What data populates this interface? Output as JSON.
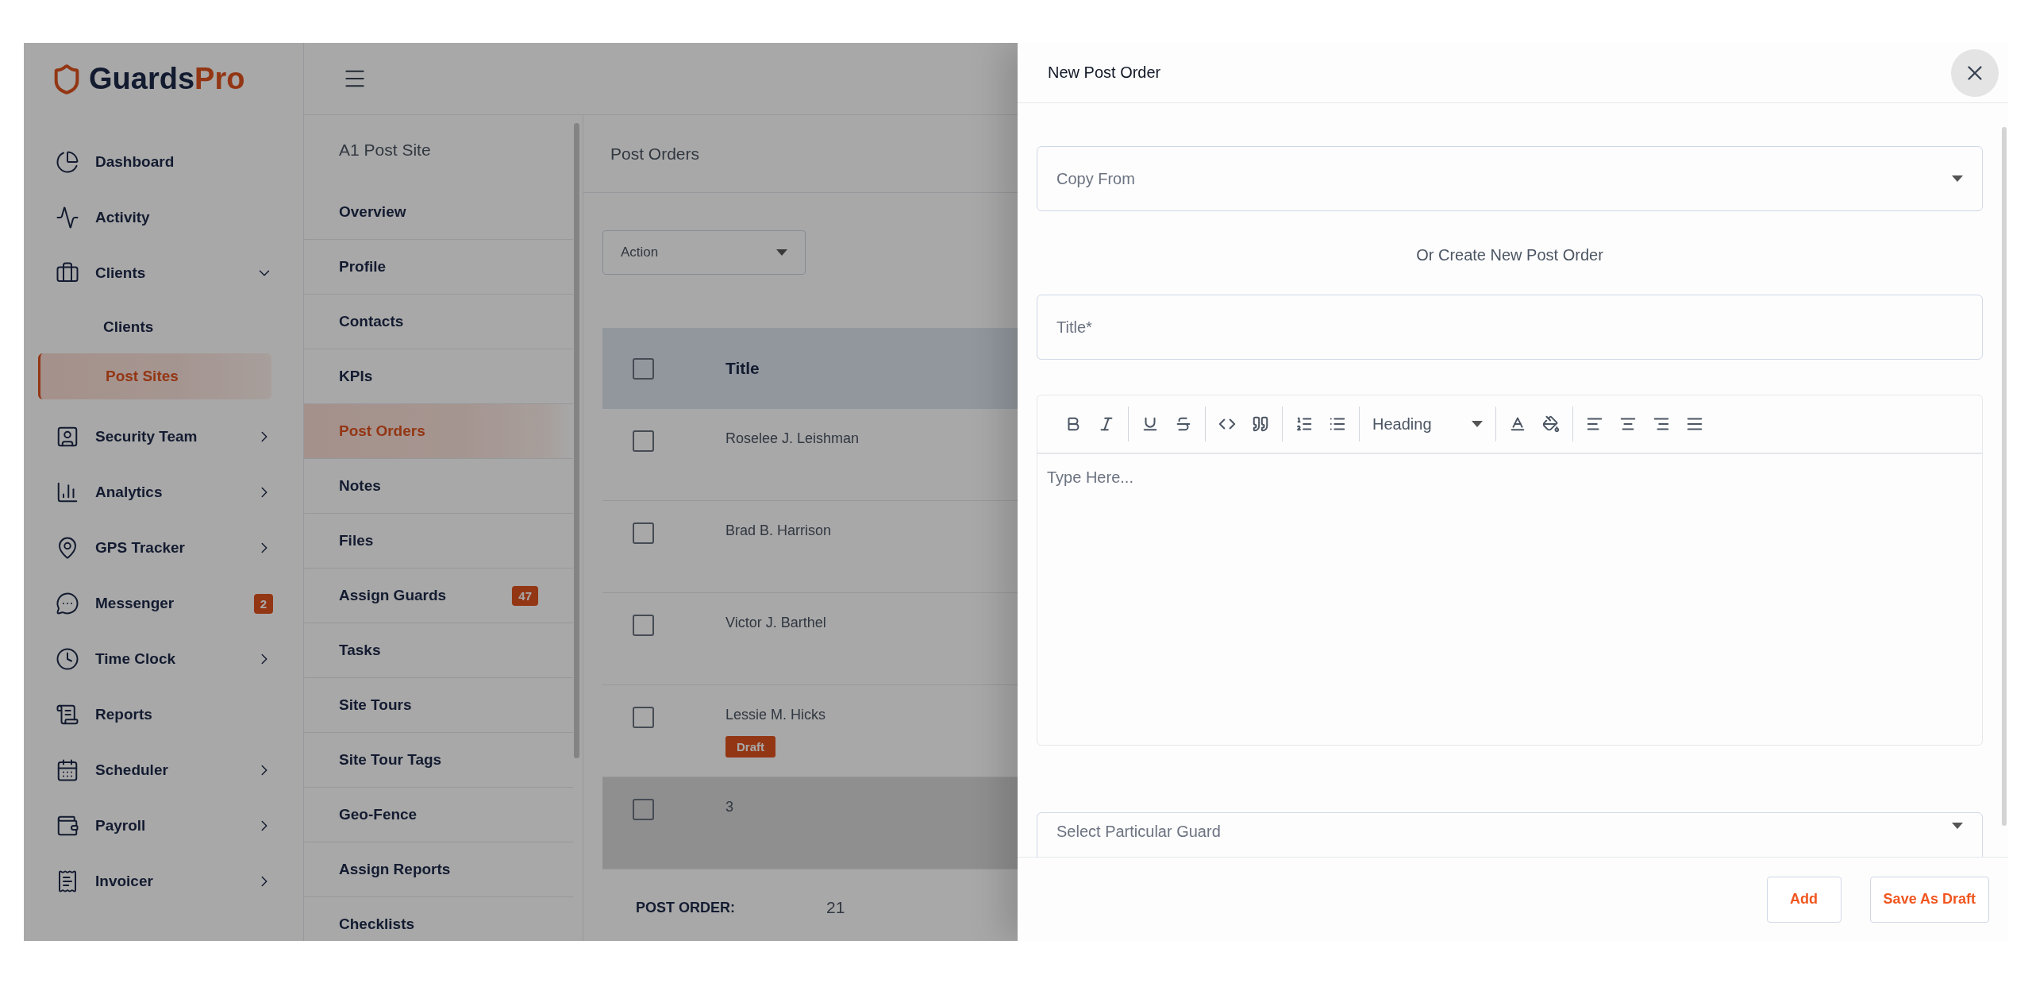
{
  "logo": {
    "first": "Guards",
    "second": "Pro"
  },
  "sidebar": {
    "items": [
      {
        "label": "Dashboard"
      },
      {
        "label": "Activity"
      },
      {
        "label": "Clients",
        "expanded": true,
        "children": [
          {
            "label": "Clients",
            "selected": false
          },
          {
            "label": "Post Sites",
            "selected": true
          }
        ]
      },
      {
        "label": "Security Team",
        "expanded": false
      },
      {
        "label": "Analytics",
        "expanded": false
      },
      {
        "label": "GPS Tracker",
        "expanded": false
      },
      {
        "label": "Messenger",
        "badge": "2"
      },
      {
        "label": "Time Clock",
        "expanded": false
      },
      {
        "label": "Reports"
      },
      {
        "label": "Scheduler",
        "expanded": false
      },
      {
        "label": "Payroll",
        "expanded": false
      },
      {
        "label": "Invoicer",
        "expanded": false
      }
    ]
  },
  "subnav": {
    "title": "A1 Post Site",
    "items": [
      {
        "label": "Overview",
        "selected": false
      },
      {
        "label": "Profile",
        "selected": false
      },
      {
        "label": "Contacts",
        "selected": false
      },
      {
        "label": "KPIs",
        "selected": false
      },
      {
        "label": "Post Orders",
        "selected": true
      },
      {
        "label": "Notes",
        "selected": false
      },
      {
        "label": "Files",
        "selected": false
      },
      {
        "label": "Assign Guards",
        "selected": false,
        "badge": "47"
      },
      {
        "label": "Tasks",
        "selected": false
      },
      {
        "label": "Site Tours",
        "selected": false
      },
      {
        "label": "Site Tour Tags",
        "selected": false
      },
      {
        "label": "Geo-Fence",
        "selected": false
      },
      {
        "label": "Assign Reports",
        "selected": false
      },
      {
        "label": "Checklists",
        "selected": false
      }
    ]
  },
  "content": {
    "title": "Post Orders",
    "action_select": {
      "placeholder": "Action"
    },
    "table": {
      "columns": [
        "Title"
      ],
      "header_checked": false,
      "rows": [
        {
          "title": "Roselee J. Leishman",
          "checked": false,
          "highlighted": false
        },
        {
          "title": "Brad B. Harrison",
          "checked": false,
          "highlighted": false
        },
        {
          "title": "Victor J. Barthel",
          "checked": false,
          "highlighted": false
        },
        {
          "title": "Lessie M. Hicks",
          "checked": false,
          "highlighted": false,
          "tag": "Draft"
        },
        {
          "title": "3",
          "checked": false,
          "highlighted": true
        }
      ]
    },
    "post_order": {
      "label": "POST ORDER:",
      "value": "21"
    }
  },
  "drawer": {
    "title": "New Post Order",
    "copy_from": {
      "placeholder": "Copy From"
    },
    "or_text": "Or Create New Post Order",
    "title_field": {
      "placeholder": "Title*"
    },
    "editor": {
      "heading_select": "Heading",
      "placeholder": "Type Here..."
    },
    "guard_select": {
      "placeholder": "Select Particular Guard"
    },
    "buttons": [
      {
        "label": "Add"
      },
      {
        "label": "Save As Draft"
      }
    ]
  }
}
